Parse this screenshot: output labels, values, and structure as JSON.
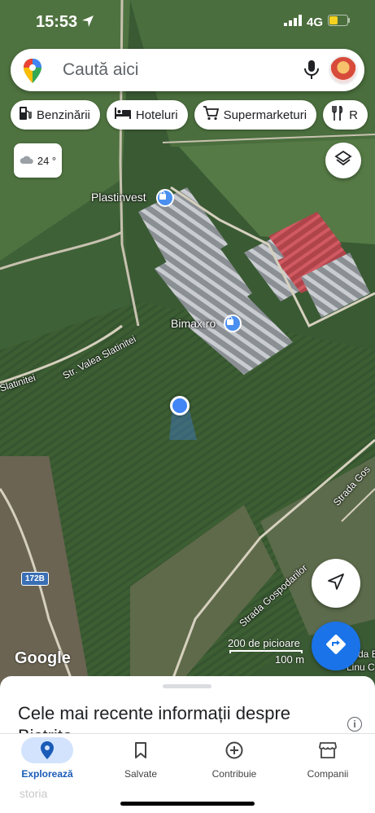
{
  "status_bar": {
    "time": "15:53",
    "network": "4G"
  },
  "search": {
    "placeholder": "Caută aici"
  },
  "chips": [
    {
      "label": "Benzinării",
      "icon": "gas-station-icon"
    },
    {
      "label": "Hoteluri",
      "icon": "bed-icon"
    },
    {
      "label": "Supermarketuri",
      "icon": "cart-icon"
    },
    {
      "label": "R",
      "icon": "restaurant-icon"
    }
  ],
  "weather": {
    "temperature": "24 °",
    "icon": "cloud-icon"
  },
  "map": {
    "places": [
      {
        "label": "Plastinvest",
        "icon": "shopping-bag-icon"
      },
      {
        "label": "Bimax.ro",
        "icon": "shopping-bag-icon"
      }
    ],
    "streets": {
      "valea_slatinitei": "Str. Valea Slatinitei",
      "slatinitei": "Slatinitei",
      "gospodarilor": "Strada Gospodarilor",
      "strada_gos": "Strada Gos",
      "route": "172B",
      "far_right": "Strada B",
      "linu": "Linu C"
    },
    "scale": {
      "feet": "200 de picioare",
      "meters": "100 m"
    },
    "logo": "Google"
  },
  "sheet": {
    "title": "Cele mai recente informații despre Bistrita"
  },
  "nav": [
    {
      "label": "Explorează",
      "icon": "location-pin-icon",
      "active": true
    },
    {
      "label": "Salvate",
      "icon": "bookmark-icon",
      "active": false
    },
    {
      "label": "Contribuie",
      "icon": "add-circle-icon",
      "active": false
    },
    {
      "label": "Companii",
      "icon": "storefront-icon",
      "active": false
    }
  ],
  "watermark": "storia",
  "colors": {
    "accent": "#1a73e8",
    "map_pin": "#4a8ff0",
    "nav_active_bg": "#d3e3fd"
  }
}
